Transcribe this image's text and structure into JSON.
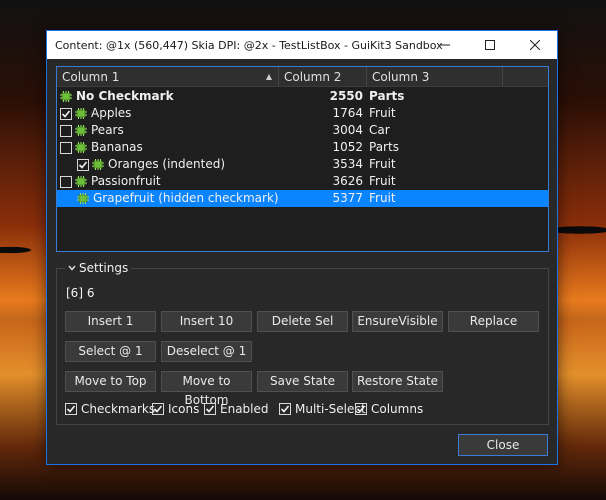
{
  "window": {
    "title": "Content: @1x (560,447) Skia DPI: @2x - TestListBox - GuiKit3 Sandbox",
    "minimize_icon": "minimize-icon",
    "maximize_icon": "maximize-icon",
    "close_icon": "close-icon"
  },
  "listbox": {
    "columns": [
      "Column 1",
      "Column 2",
      "Column 3"
    ],
    "rows": [
      {
        "name": "No Checkmark",
        "value": "2550",
        "category": "Parts",
        "checkbox": false,
        "checked": false,
        "bold": true,
        "indent": false,
        "selected": false
      },
      {
        "name": "Apples",
        "value": "1764",
        "category": "Fruit",
        "checkbox": true,
        "checked": true,
        "bold": false,
        "indent": false,
        "selected": false
      },
      {
        "name": "Pears",
        "value": "3004",
        "category": "Car",
        "checkbox": true,
        "checked": false,
        "bold": false,
        "indent": false,
        "selected": false
      },
      {
        "name": "Bananas",
        "value": "1052",
        "category": "Parts",
        "checkbox": true,
        "checked": false,
        "bold": false,
        "indent": false,
        "selected": false
      },
      {
        "name": "Oranges (indented)",
        "value": "3534",
        "category": "Fruit",
        "checkbox": true,
        "checked": true,
        "bold": false,
        "indent": true,
        "selected": false
      },
      {
        "name": "Passionfruit",
        "value": "3626",
        "category": "Fruit",
        "checkbox": true,
        "checked": false,
        "bold": false,
        "indent": false,
        "selected": false
      },
      {
        "name": "Grapefruit (hidden checkmark)",
        "value": "5377",
        "category": "Fruit",
        "checkbox": false,
        "checked": false,
        "bold": false,
        "indent": true,
        "selected": true
      }
    ]
  },
  "settings": {
    "label": "Settings",
    "count_text": "[6] 6",
    "buttons_row1": [
      "Insert 1",
      "Insert 10",
      "Delete Sel",
      "EnsureVisible",
      "Replace"
    ],
    "buttons_row2": [
      "Select @ 1",
      "Deselect @ 1"
    ],
    "buttons_row3": [
      "Move to Top",
      "Move to Bottom",
      "Save State",
      "Restore State"
    ],
    "checkboxes": [
      {
        "label": "Checkmarks",
        "checked": true
      },
      {
        "label": "Icons",
        "checked": true
      },
      {
        "label": "Enabled",
        "checked": true
      },
      {
        "label": "Multi-Select",
        "checked": true
      },
      {
        "label": "Columns",
        "checked": true
      }
    ]
  },
  "footer": {
    "close_label": "Close"
  },
  "colors": {
    "accent": "#0a84ff",
    "window_bg": "#282828",
    "list_bg": "#1e1e1e",
    "border_focus": "#3a7bd5"
  }
}
